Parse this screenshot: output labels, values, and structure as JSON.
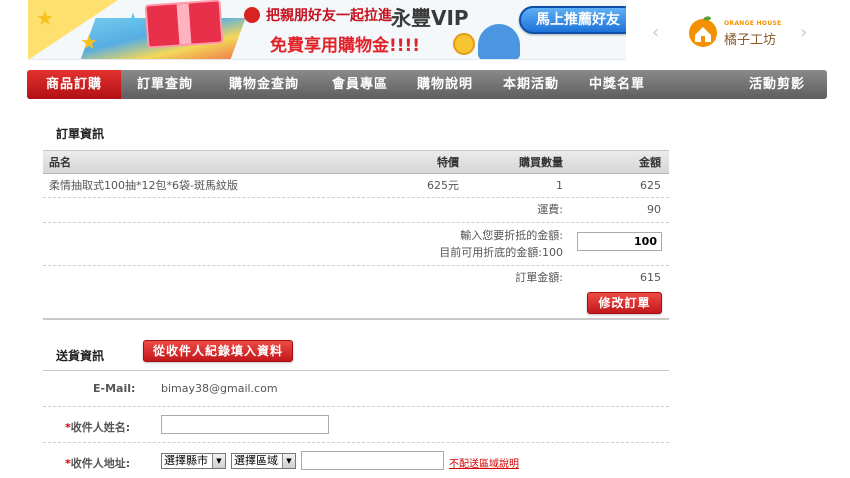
{
  "banner": {
    "line1": "把親朋好友一起拉進",
    "vip": "永豐VIP",
    "line2": "免費享用購物金!!!!",
    "cta": "馬上推薦好友"
  },
  "brand": {
    "name_en": "ORANGE HOUSE",
    "name_zh": "橘子工坊",
    "prev": "‹",
    "next": "›"
  },
  "nav": {
    "items": [
      "商品訂購",
      "訂單查詢",
      "購物金查詢",
      "會員專區",
      "購物說明",
      "本期活動",
      "中獎名單",
      "活動剪影"
    ]
  },
  "order": {
    "title": "訂單資訊",
    "columns": {
      "name": "品名",
      "price": "特價",
      "qty": "購買數量",
      "amount": "金額"
    },
    "items": [
      {
        "name": "柔情抽取式100抽*12包*6袋-斑馬紋版",
        "price": "625元",
        "qty": "1",
        "amount": "625"
      }
    ],
    "shipping_label": "運費:",
    "shipping_value": "90",
    "discount_label": "輸入您要折抵的金額:",
    "discount_value": "100",
    "available_label": "目前可用折底的金額:100",
    "total_label": "訂單金額:",
    "total_value": "615",
    "modify_button": "修改訂單"
  },
  "shipping": {
    "title": "送貨資訊",
    "fill_button": "從收件人紀錄填入資料",
    "email_label": "E-Mail:",
    "email_value": "bimay38@gmail.com",
    "required_mark": "*",
    "name_label": "收件人姓名:",
    "address_label": "收件人地址:",
    "county_select": "選擇縣市",
    "district_select": "選擇區域",
    "no_delivery_link": "不配送區域說明"
  }
}
